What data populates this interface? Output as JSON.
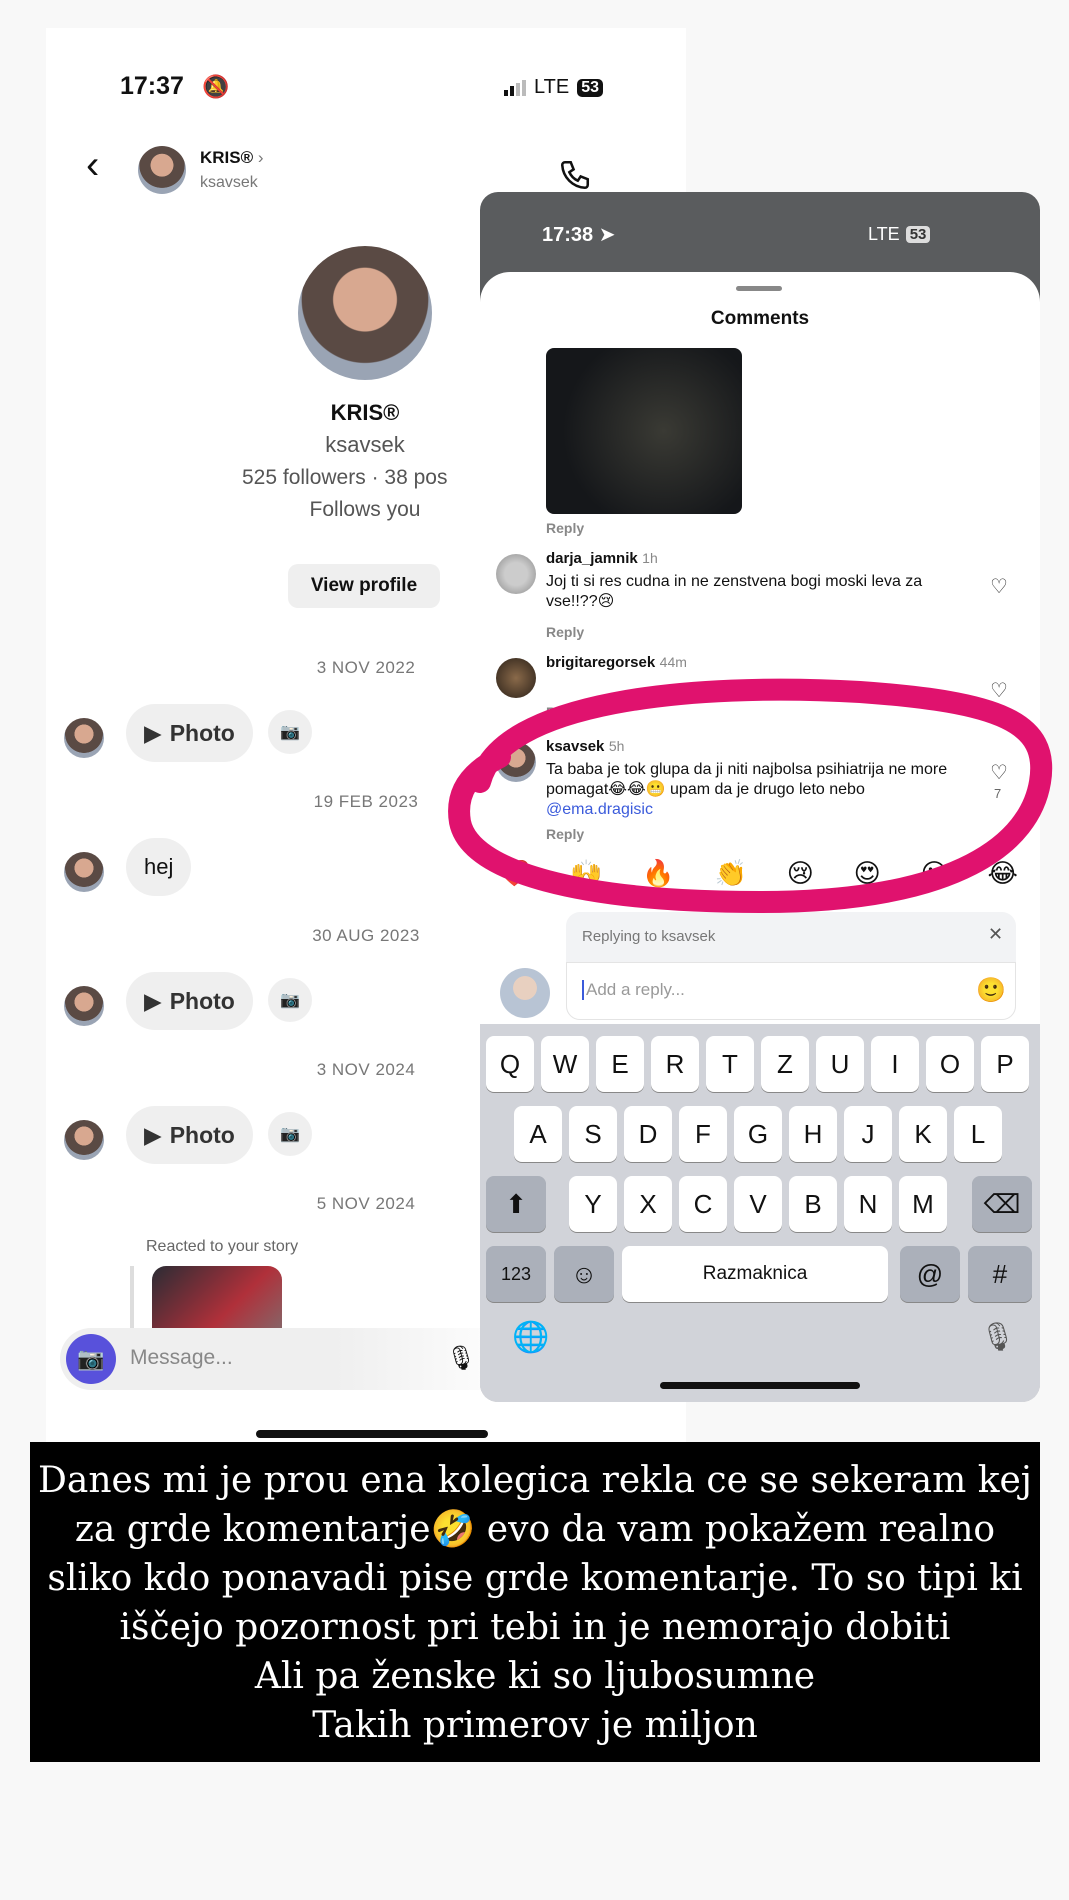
{
  "dm": {
    "status": {
      "time": "17:37",
      "network": "LTE",
      "battery": "53"
    },
    "header": {
      "name": "KRIS®",
      "username": "ksavsek"
    },
    "profile": {
      "name": "KRIS®",
      "username": "ksavsek",
      "stats": "525 followers · 38 pos",
      "follows": "Follows you",
      "view_profile": "View profile"
    },
    "thread": [
      {
        "date": "3 NOV 2022",
        "bubble": "Photo"
      },
      {
        "date": "19 FEB 2023",
        "bubble": "hej"
      },
      {
        "date": "30 AUG 2023",
        "bubble": "Photo"
      },
      {
        "date": "3 NOV 2024",
        "bubble": "Photo"
      },
      {
        "date": "5 NOV 2024",
        "reacted": "Reacted to your story"
      }
    ],
    "composer": {
      "placeholder": "Message..."
    }
  },
  "comments": {
    "status": {
      "time": "17:38",
      "network": "LTE",
      "battery": "53"
    },
    "title": "Comments",
    "reply_label": "Reply",
    "items": [
      {
        "user": "darja_jamnik",
        "time": "1h",
        "text": "Joj ti si res cudna in ne zenstvena bogi moski leva za vse!!??😢"
      },
      {
        "user": "brigitaregorsek",
        "time": "44m",
        "text": ""
      },
      {
        "user": "ksavsek",
        "time": "5h",
        "text": "Ta baba je tok glupa da ji niti najbolsa psihiatrija ne more pomagat😂😂😬 upam da je drugo leto nebo ",
        "mention": "@ema.dragisic",
        "likes": "7"
      }
    ],
    "emoji_bar": [
      "❤️",
      "🙌",
      "🔥",
      "👏",
      "😢",
      "😍",
      "😮",
      "😂"
    ],
    "replying_to": "Replying to ksavsek",
    "reply_placeholder": "Add a reply...",
    "keyboard": {
      "row1": [
        "Q",
        "W",
        "E",
        "R",
        "T",
        "Z",
        "U",
        "I",
        "O",
        "P"
      ],
      "row2": [
        "A",
        "S",
        "D",
        "F",
        "G",
        "H",
        "J",
        "K",
        "L"
      ],
      "row3": [
        "Y",
        "X",
        "C",
        "V",
        "B",
        "N",
        "M"
      ],
      "numbers": "123",
      "space": "Razmaknica",
      "at": "@",
      "hash": "#"
    }
  },
  "caption": [
    "Danes mi je prou ena kolegica rekla ce se sekeram kej",
    "za grde komentarje🤣 evo da vam pokažem realno",
    "sliko kdo ponavadi pise grde komentarje. To so tipi ki",
    "iščejo pozornost pri tebi in je nemorajo dobiti",
    "Ali pa ženske ki so ljubosumne",
    "Takih primerov je miljon"
  ],
  "colors": {
    "highlight": "#e0126e",
    "link": "#3b5bdb",
    "instagram_blue": "#5851db"
  }
}
